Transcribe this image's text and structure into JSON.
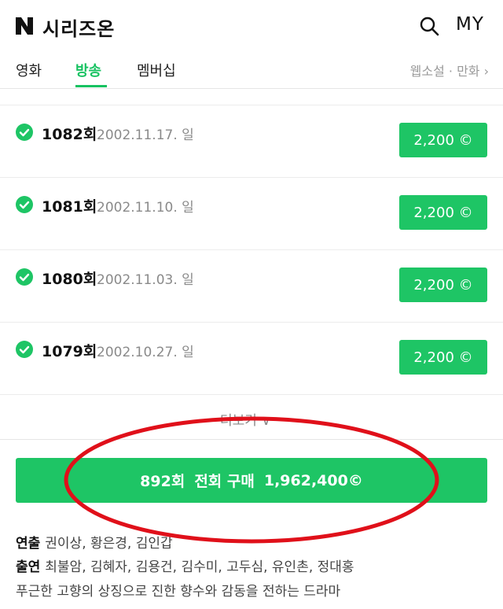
{
  "header": {
    "app_title": "시리즈온",
    "my_label": "MY",
    "icons": [
      "naver-n-logo",
      "search-icon"
    ]
  },
  "tabs": {
    "items": [
      {
        "label": "영화",
        "active": false
      },
      {
        "label": "방송",
        "active": true
      },
      {
        "label": "멤버십",
        "active": false
      }
    ],
    "more_label": "웹소설 · 만화 ›"
  },
  "episodes": [
    {
      "number": "1082회",
      "date": "2002.11.17. 일",
      "price": "2,200 ©"
    },
    {
      "number": "1081회",
      "date": "2002.11.10. 일",
      "price": "2,200 ©"
    },
    {
      "number": "1080회",
      "date": "2002.11.03. 일",
      "price": "2,200 ©"
    },
    {
      "number": "1079회",
      "date": "2002.10.27. 일",
      "price": "2,200 ©"
    }
  ],
  "more_button": "더보기 ∨",
  "purchase": {
    "count": "892회",
    "label": "전회 구매",
    "price": "1,962,400©"
  },
  "info": {
    "director_label": "연출",
    "director_value": "권이상, 황은경, 김인갑",
    "cast_label": "출연",
    "cast_value": "최불암, 김혜자, 김용건, 김수미, 고두심, 유인촌, 정대홍",
    "description": "푸근한 고향의 상징으로 진한 향수와 감동을 전하는 드라마"
  },
  "colors": {
    "accent_green": "#1ec565",
    "tab_active": "#17c261",
    "annotation_red": "#e0101a"
  }
}
